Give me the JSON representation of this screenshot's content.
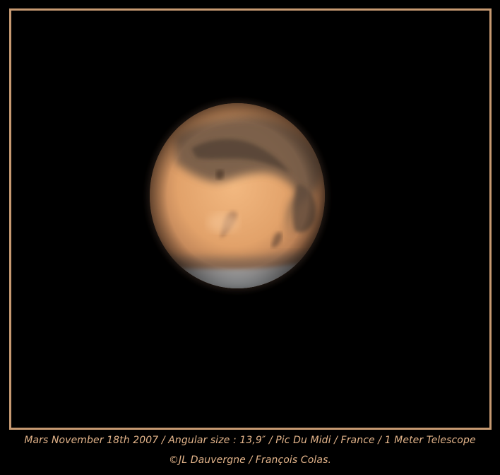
{
  "caption": {
    "line1": "Mars November 18th 2007 / Angular size : 13,9″ / Pic Du Midi / France / 1 Meter Telescope",
    "line2": "©JL Dauvergne / François Colas."
  },
  "colors": {
    "background": "#000000",
    "frame_border": "#c79a72",
    "caption_text": "#e3b48a",
    "mars_surface": "#e6a66d",
    "mars_dark_regions": "#6b5544",
    "polar_cap": "#b9c3cc"
  }
}
